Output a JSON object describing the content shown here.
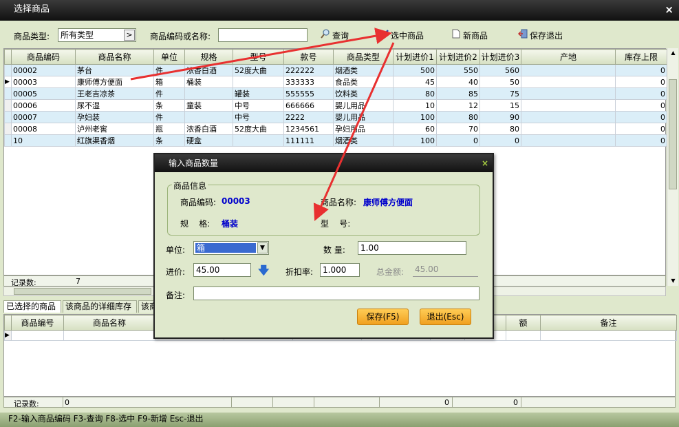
{
  "window": {
    "title": "选择商品",
    "close": "×"
  },
  "toolbar": {
    "type_label": "商品类型:",
    "type_value": "所有类型",
    "type_btn": ">",
    "search_label": "商品编码或名称:",
    "search_value": "",
    "query": "查询",
    "select": "选中商品",
    "new": "新商品",
    "save_exit": "保存退出"
  },
  "grid": {
    "headers": [
      "商品编码",
      "商品名称",
      "单位",
      "规格",
      "型号",
      "款号",
      "商品类型",
      "计划进价1",
      "计划进价2",
      "计划进价3",
      "产地",
      "库存上限"
    ],
    "rows": [
      [
        "00002",
        "茅台",
        "件",
        "浓香白酒",
        "52度大曲",
        "222222",
        "烟酒类",
        "500",
        "550",
        "560",
        "",
        "0"
      ],
      [
        "00003",
        "康师傅方便面",
        "箱",
        "桶装",
        "",
        "333333",
        "食品类",
        "45",
        "40",
        "50",
        "",
        "0"
      ],
      [
        "00005",
        "王老吉凉茶",
        "件",
        "",
        "罐装",
        "555555",
        "饮料类",
        "80",
        "85",
        "75",
        "",
        "0"
      ],
      [
        "00006",
        "尿不湿",
        "条",
        "童装",
        "中号",
        "666666",
        "婴儿用品",
        "10",
        "12",
        "15",
        "",
        "0"
      ],
      [
        "00007",
        "孕妇装",
        "件",
        "",
        "中号",
        "2222",
        "婴儿用品",
        "100",
        "80",
        "90",
        "",
        "0"
      ],
      [
        "00008",
        "泸州老窖",
        "瓶",
        "浓香白酒",
        "52度大曲",
        "1234561",
        "孕妇用品",
        "60",
        "70",
        "80",
        "",
        "0"
      ],
      [
        "10",
        "红旗渠香烟",
        "条",
        "硬盒",
        "",
        "111111",
        "烟酒类",
        "100",
        "0",
        "0",
        "",
        "0"
      ]
    ],
    "record_label": "记录数:",
    "record_count": "7"
  },
  "tabs": [
    "已选择的商品",
    "该商品的详细库存",
    "该商"
  ],
  "grid2": {
    "headers": [
      "商品编号",
      "商品名称",
      "",
      "",
      "",
      "",
      "",
      "",
      "额",
      "备注"
    ],
    "record_label": "记录数:",
    "record_count": "0",
    "sum1": "0",
    "sum2": "0"
  },
  "status": "F2-输入商品编码 F3-查询 F8-选中 F9-新增 Esc-退出",
  "dialog": {
    "title": "输入商品数量",
    "close": "×",
    "group": "商品信息",
    "code_label": "商品编码:",
    "code_value": "00003",
    "name_label": "商品名称:",
    "name_value": "康师傅方便面",
    "spec_label": "规    格:",
    "spec_value": "桶装",
    "model_label": "型    号:",
    "unit_label": "单位:",
    "unit_value": "箱",
    "qty_label": "数  量:",
    "qty_value": "1.00",
    "price_label": "进价:",
    "price_value": "45.00",
    "discount_label": "折扣率:",
    "discount_value": "1.000",
    "total_label": "总金额:",
    "total_value": "45.00",
    "note_label": "备注:",
    "note_value": "",
    "save": "保存(F5)",
    "exit": "退出(Esc)"
  },
  "colors": {
    "annotation_arrow": "#e83030",
    "accent_blue": "#0000cc",
    "button_orange": "#f0a020"
  }
}
